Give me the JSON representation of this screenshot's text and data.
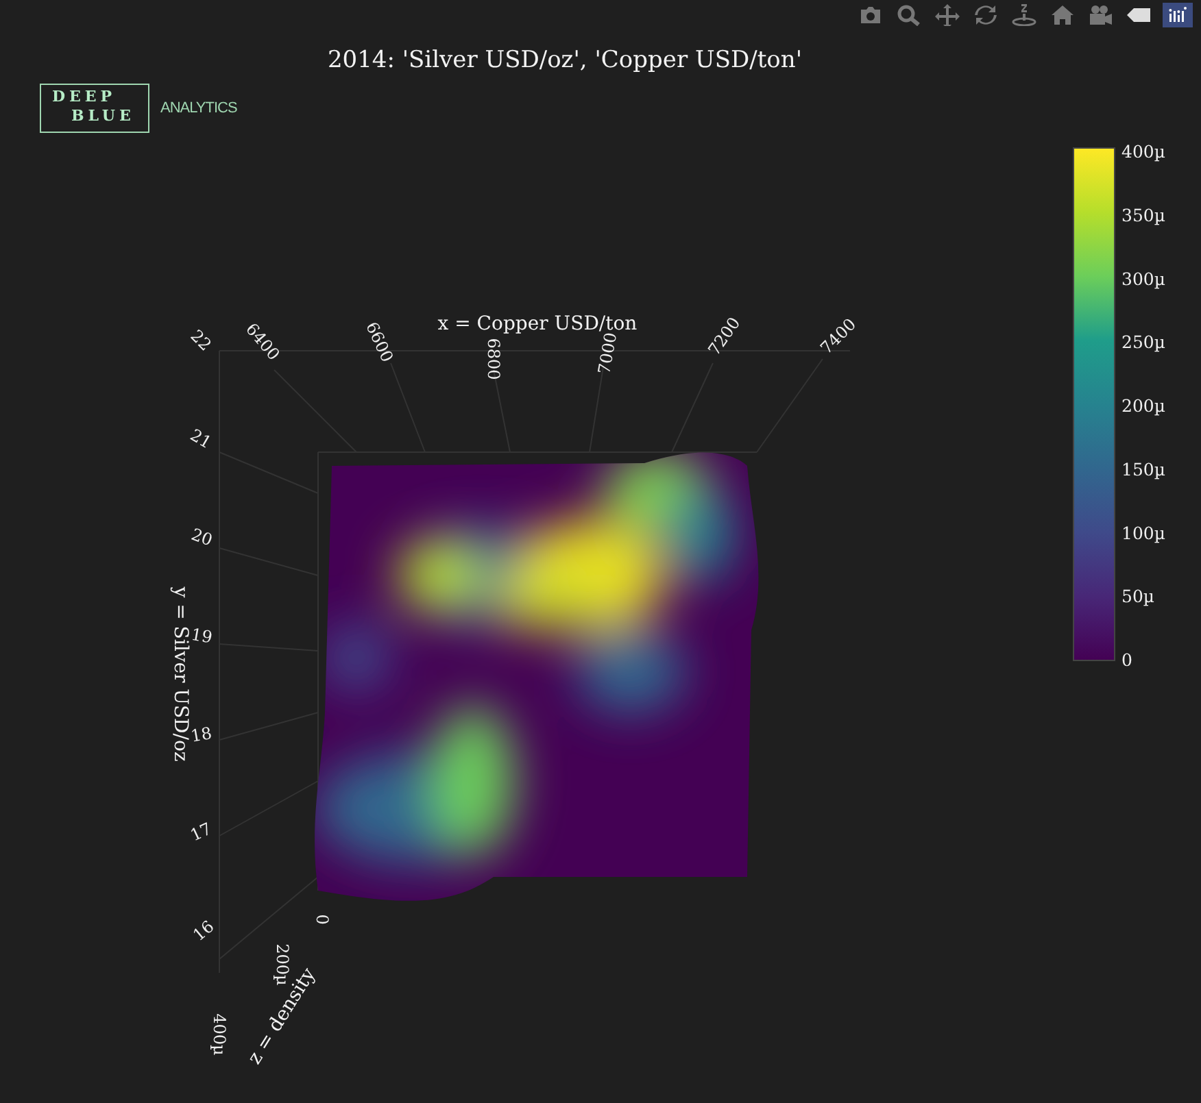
{
  "modebar": [
    {
      "kind": "camera"
    },
    {
      "kind": "zoom"
    },
    {
      "kind": "pan"
    },
    {
      "kind": "orbit"
    },
    {
      "kind": "turntable"
    },
    {
      "kind": "home"
    },
    {
      "kind": "video"
    },
    {
      "kind": "tag"
    },
    {
      "kind": "logo"
    }
  ],
  "logo": {
    "line1": "DEEP",
    "line2": "BLUE",
    "tagline": "ANALYTICS"
  },
  "title": "2014: 'Silver USD/oz', 'Copper USD/ton'",
  "scene": {
    "x_axis": {
      "title": "x = Copper USD/ton",
      "ticks": [
        "6400",
        "6600",
        "6800",
        "7000",
        "7200",
        "7400"
      ]
    },
    "y_axis": {
      "title": "y = Silver USD/oz",
      "ticks": [
        "22",
        "21",
        "20",
        "19",
        "18",
        "17",
        "16"
      ]
    },
    "z_axis": {
      "title": "z = density",
      "ticks": [
        "0",
        "200µ",
        "400µ"
      ]
    }
  },
  "colorbar": {
    "ticks": [
      "400µ",
      "350µ",
      "300µ",
      "250µ",
      "200µ",
      "150µ",
      "100µ",
      "50µ",
      "0"
    ]
  }
}
